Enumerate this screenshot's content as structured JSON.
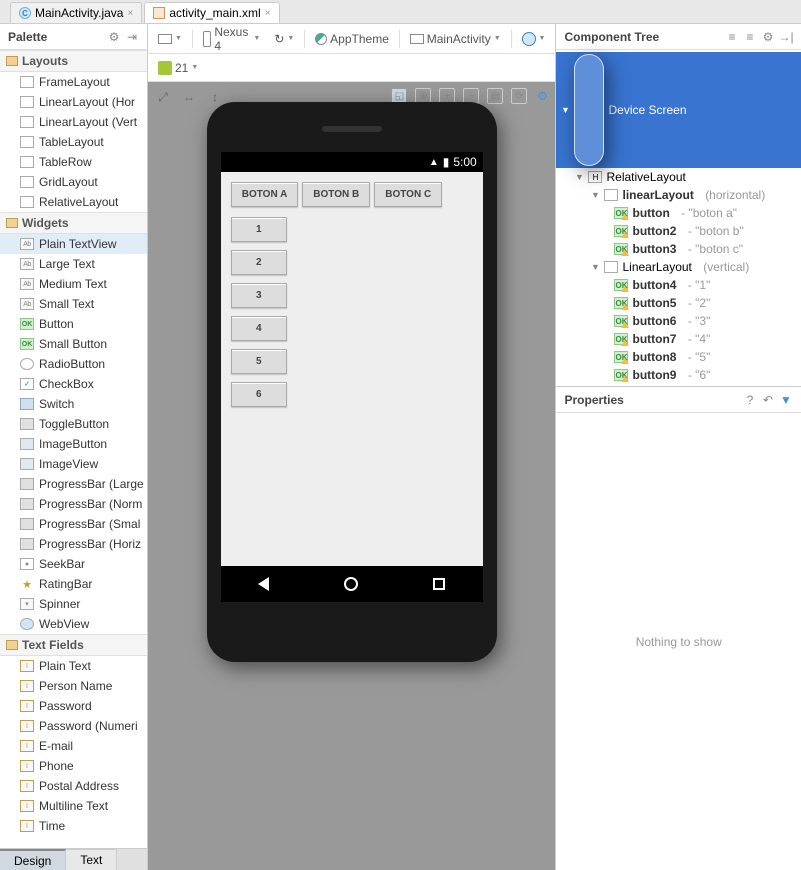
{
  "tabs": {
    "file1": "MainActivity.java",
    "file2": "activity_main.xml"
  },
  "palette": {
    "title": "Palette",
    "groups": {
      "layouts": "Layouts",
      "widgets": "Widgets",
      "textfields": "Text Fields"
    },
    "layouts": {
      "frame": "FrameLayout",
      "linh": "LinearLayout (Hor",
      "linv": "LinearLayout (Vert",
      "table": "TableLayout",
      "row": "TableRow",
      "grid": "GridLayout",
      "rel": "RelativeLayout"
    },
    "widgets": {
      "ptv": "Plain TextView",
      "lt": "Large Text",
      "mt": "Medium Text",
      "st": "Small Text",
      "btn": "Button",
      "sbtn": "Small Button",
      "radio": "RadioButton",
      "check": "CheckBox",
      "switch": "Switch",
      "toggle": "ToggleButton",
      "imgb": "ImageButton",
      "imgv": "ImageView",
      "pbl": "ProgressBar (Large",
      "pbn": "ProgressBar (Norm",
      "pbs": "ProgressBar (Smal",
      "pbh": "ProgressBar (Horiz",
      "seek": "SeekBar",
      "rating": "RatingBar",
      "spin": "Spinner",
      "web": "WebView"
    },
    "textfields": {
      "plain": "Plain Text",
      "person": "Person Name",
      "pass": "Password",
      "passn": "Password (Numeri",
      "email": "E-mail",
      "phone": "Phone",
      "postal": "Postal Address",
      "multi": "Multiline Text",
      "time": "Time"
    }
  },
  "toolbar": {
    "device": "Nexus 4",
    "theme": "AppTheme",
    "activity": "MainActivity",
    "api": "21"
  },
  "app": {
    "time": "5:00",
    "btnA": "BOTON A",
    "btnB": "BOTON B",
    "btnC": "BOTON C",
    "b1": "1",
    "b2": "2",
    "b3": "3",
    "b4": "4",
    "b5": "5",
    "b6": "6"
  },
  "tree": {
    "title": "Component Tree",
    "root": "Device Screen",
    "rel": "RelativeLayout",
    "lin1": "linearLayout",
    "lin1_suffix": "(horizontal)",
    "btn": "button",
    "btn_s": "- \"boton a\"",
    "btn2": "button2",
    "btn2_s": "- \"boton b\"",
    "btn3": "button3",
    "btn3_s": "- \"boton c\"",
    "lin2": "LinearLayout",
    "lin2_suffix": "(vertical)",
    "btn4": "button4",
    "btn4_s": "- \"1\"",
    "btn5": "button5",
    "btn5_s": "- \"2\"",
    "btn6": "button6",
    "btn6_s": "- \"3\"",
    "btn7": "button7",
    "btn7_s": "- \"4\"",
    "btn8": "button8",
    "btn8_s": "- \"5\"",
    "btn9": "button9",
    "btn9_s": "- \"6\""
  },
  "properties": {
    "title": "Properties",
    "empty": "Nothing to show"
  },
  "bottom": {
    "design": "Design",
    "text": "Text"
  }
}
